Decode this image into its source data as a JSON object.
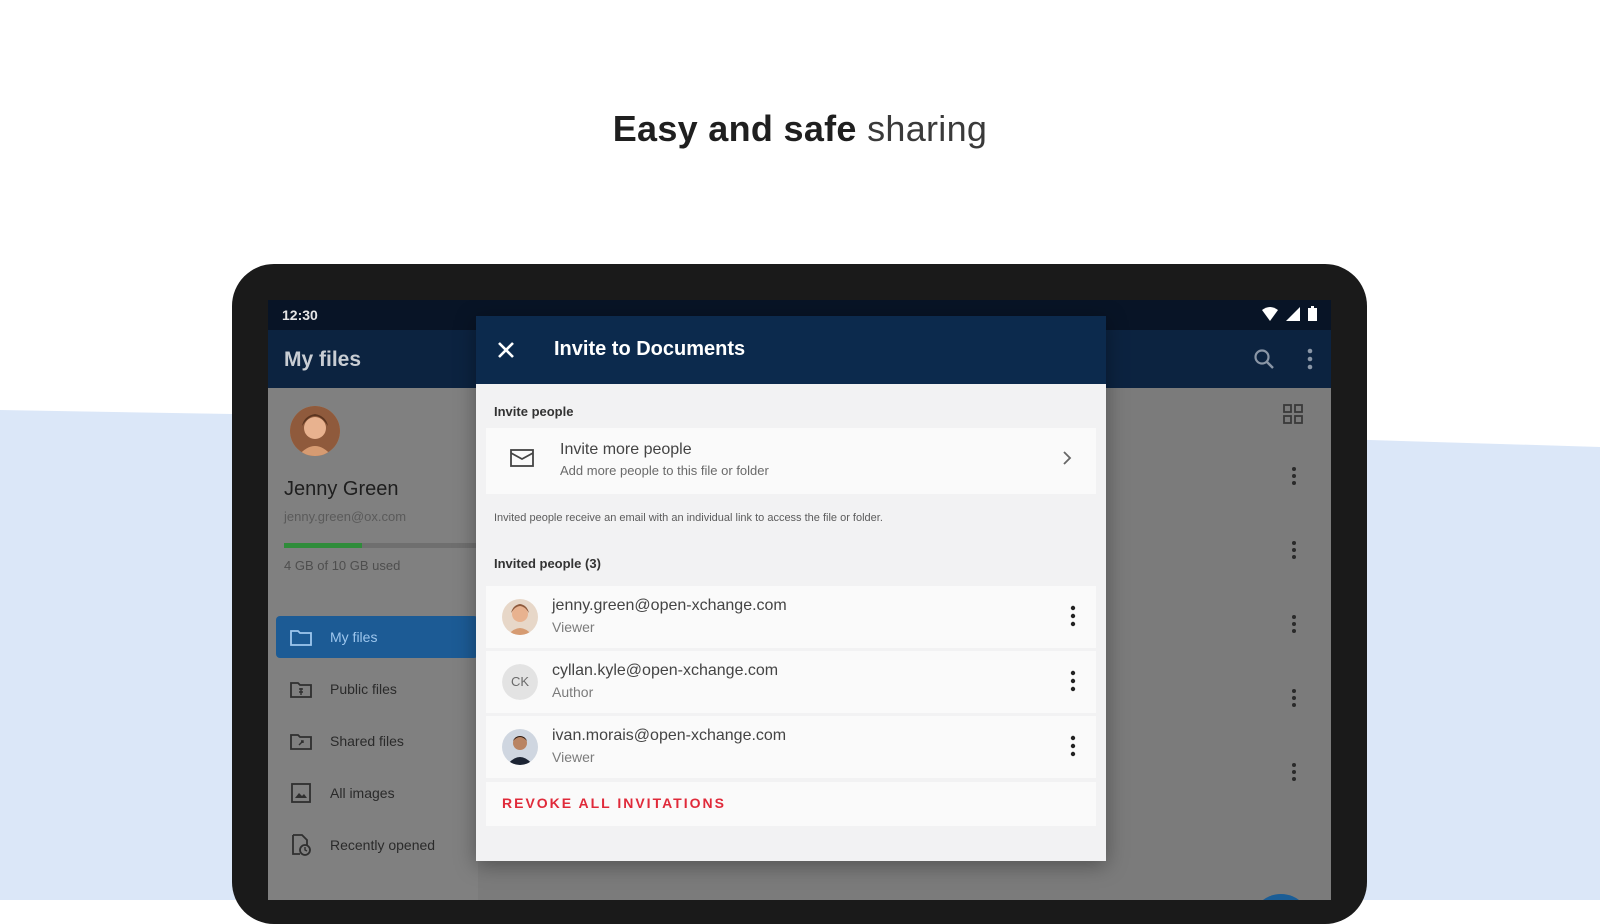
{
  "headline": {
    "bold": "Easy and safe",
    "light": "sharing"
  },
  "status_bar": {
    "time": "12:30"
  },
  "app_bar": {
    "title": "My files"
  },
  "drawer": {
    "user_name": "Jenny Green",
    "user_email": "jenny.green@ox.com",
    "quota_text": "4 GB of 10 GB used",
    "quota_fraction": 0.4,
    "nav": [
      {
        "label": "My files",
        "icon": "folder-icon",
        "active": true
      },
      {
        "label": "Public files",
        "icon": "public-folder-icon",
        "active": false
      },
      {
        "label": "Shared files",
        "icon": "shared-folder-icon",
        "active": false
      },
      {
        "label": "All images",
        "icon": "image-icon",
        "active": false
      },
      {
        "label": "Recently opened",
        "icon": "recent-file-icon",
        "active": false
      }
    ]
  },
  "dialog": {
    "title": "Invite to Documents",
    "invite_section_label": "Invite people",
    "invite_more": {
      "title": "Invite more people",
      "subtitle": "Add more people to this file or folder"
    },
    "hint": "Invited people receive an email with an individual link to access the file or folder.",
    "invited_section_label": "Invited people (3)",
    "people": [
      {
        "email": "jenny.green@open-xchange.com",
        "role": "Viewer",
        "avatar": "photo"
      },
      {
        "email": "cyllan.kyle@open-xchange.com",
        "role": "Author",
        "avatar": "initials",
        "initials": "CK"
      },
      {
        "email": "ivan.morais@open-xchange.com",
        "role": "Viewer",
        "avatar": "photo"
      }
    ],
    "revoke_label": "REVOKE ALL INVITATIONS"
  },
  "colors": {
    "app_bar": "#0c2340",
    "dialog_header": "#0c2a4d",
    "active_nav": "#1c5b95",
    "revoke": "#e02a3a",
    "fab": "#1a5d96",
    "background_wave": "#dbe7f8"
  }
}
